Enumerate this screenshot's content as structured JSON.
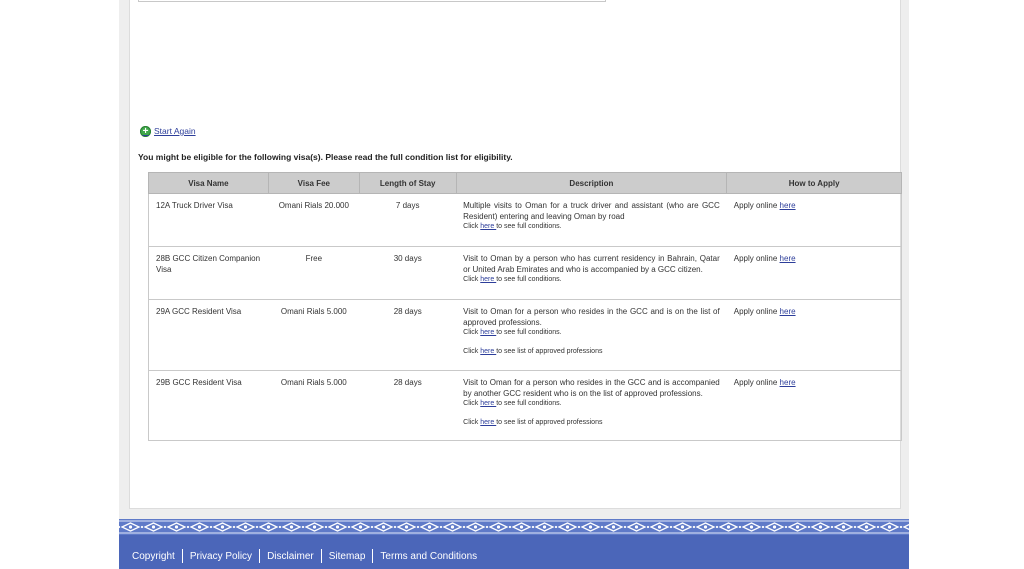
{
  "start_again": {
    "label": "Start Again"
  },
  "eligible_message": "You might be eligible for the following visa(s). Please read the full condition list for eligibility.",
  "table": {
    "headers": [
      "Visa Name",
      "Visa Fee",
      "Length of Stay",
      "Description",
      "How to Apply"
    ],
    "rows": [
      {
        "name": "12A Truck Driver Visa",
        "fee": "Omani Rials 20.000",
        "stay": "7 days",
        "description": "Multiple visits to Oman for a truck driver and assistant (who are GCC Resident) entering and leaving Oman by road",
        "conditions_prefix": "Click ",
        "conditions_link": "here ",
        "conditions_suffix": "to see full conditions.",
        "apply_text": "Apply online ",
        "apply_link": "here"
      },
      {
        "name": "28B GCC Citizen Companion Visa",
        "fee": "Free",
        "stay": "30 days",
        "description": "Visit to Oman by a person who has current residency in Bahrain, Qatar or United Arab Emirates and who is accompanied by a GCC citizen.",
        "conditions_prefix": "Click ",
        "conditions_link": "here ",
        "conditions_suffix": "to see full conditions.",
        "apply_text": "Apply online ",
        "apply_link": "here"
      },
      {
        "name": "29A GCC Resident Visa",
        "fee": "Omani Rials 5.000",
        "stay": "28 days",
        "description": "Visit to Oman for a person who resides in the GCC and is on the list of approved professions.",
        "conditions_prefix": "Click ",
        "conditions_link": "here ",
        "conditions_suffix": "to see full conditions.",
        "professions_prefix": "Click ",
        "professions_link": "here ",
        "professions_suffix": "to see list of approved professions",
        "apply_text": "Apply online ",
        "apply_link": "here"
      },
      {
        "name": "29B GCC Resident Visa",
        "fee": "Omani Rials 5.000",
        "stay": "28 days",
        "description": "Visit to Oman for a person who resides in the GCC and is accompanied by another GCC resident who is on the list of approved professions.",
        "conditions_prefix": "Click ",
        "conditions_link": "here ",
        "conditions_suffix": "to see full conditions.",
        "professions_prefix": "Click ",
        "professions_link": "here ",
        "professions_suffix": "to see list of approved professions",
        "apply_text": "Apply online ",
        "apply_link": "here"
      }
    ]
  },
  "footer": {
    "links": [
      "Copyright",
      "Privacy Policy",
      "Disclaimer",
      "Sitemap",
      "Terms and Conditions"
    ]
  },
  "colors": {
    "footer_bg": "#4b66b9",
    "link": "#2d3e9a",
    "header_bg": "#cccccc",
    "plus_icon": "#3fa84a"
  }
}
